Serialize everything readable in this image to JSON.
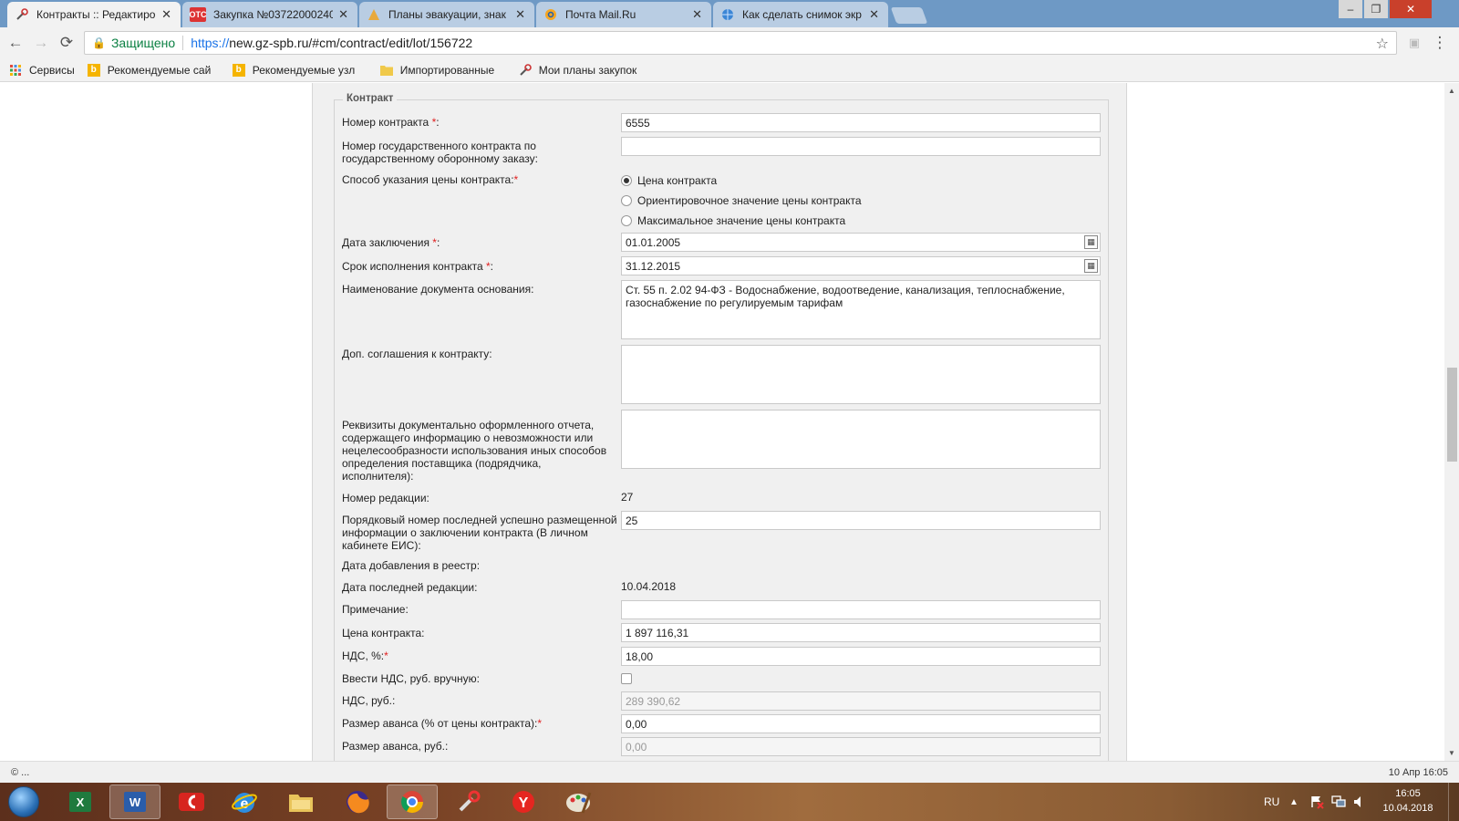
{
  "browser": {
    "tabs": [
      {
        "title": "Контракты :: Редактиров",
        "icon": "tools-icon",
        "active": true
      },
      {
        "title": "Закупка №03722000240",
        "icon": "otc-icon",
        "active": false
      },
      {
        "title": "Планы эвакуации, знак",
        "icon": "evac-icon",
        "active": false
      },
      {
        "title": "Почта Mail.Ru",
        "icon": "mail-icon",
        "active": false
      },
      {
        "title": "Как сделать снимок экр",
        "icon": "globe-icon",
        "active": false
      }
    ],
    "otc_badge": "OTC",
    "secure_label": "Защищено",
    "url_scheme": "https://",
    "url_host": "new.gz-spb.ru",
    "url_path": "/#cm/contract/edit/lot/156722",
    "bookmarks": [
      {
        "label": "Сервисы",
        "icon": "apps-icon"
      },
      {
        "label": "Рекомендуемые сай",
        "icon": "bing-icon"
      },
      {
        "label": "Рекомендуемые узл",
        "icon": "bing-icon"
      },
      {
        "label": "Импортированные",
        "icon": "folder-icon"
      },
      {
        "label": "Мои планы закупок",
        "icon": "tools-icon"
      }
    ]
  },
  "form": {
    "legend": "Контракт",
    "contract_number": {
      "label": "Номер контракта ",
      "value": "6555"
    },
    "gov_contract_number": {
      "label": "Номер государственного контракта по государственному оборонному заказу:",
      "value": ""
    },
    "price_method": {
      "label": "Способ указания цены контракта:",
      "options": [
        "Цена контракта",
        "Ориентировочное значение цены контракта",
        "Максимальное значение цены контракта"
      ],
      "selected": 0
    },
    "conclusion_date": {
      "label": "Дата заключения ",
      "value": "01.01.2005"
    },
    "execution_term": {
      "label": "Срок исполнения контракта ",
      "value": "31.12.2015"
    },
    "basis_document": {
      "label": "Наименование документа основания:",
      "value": "Ст. 55 п. 2.02 94-ФЗ - Водоснабжение, водоотведение, канализация, теплоснабжение, газоснабжение по регулируемым тарифам"
    },
    "supplementary": {
      "label": "Доп. соглашения к контракту:",
      "value": ""
    },
    "report_details": {
      "label": "Реквизиты документально оформленного отчета, содержащего информацию о невозможности или нецелесообразности использования иных способов определения поставщика (подрядчика, исполнителя):",
      "value": ""
    },
    "revision_number": {
      "label": "Номер редакции:",
      "value": "27"
    },
    "last_info_number": {
      "label": "Порядковый номер последней успешно размещенной информации о заключении контракта (В личном кабинете ЕИС):",
      "value": "25"
    },
    "registry_date": {
      "label": "Дата добавления в реестр:",
      "value": ""
    },
    "last_revision_date": {
      "label": "Дата последней редакции:",
      "value": "10.04.2018"
    },
    "note": {
      "label": "Примечание:",
      "value": ""
    },
    "contract_price": {
      "label": "Цена контракта:",
      "value": "1 897 116,31"
    },
    "vat_percent": {
      "label": "НДС, %:",
      "value": "18,00"
    },
    "vat_manual": {
      "label": "Ввести НДС, руб. вручную:",
      "checked": false
    },
    "vat_rub": {
      "label": "НДС, руб.:",
      "value": "289 390,62"
    },
    "advance_percent": {
      "label": "Размер аванса (% от цены контракта):",
      "value": "0,00"
    },
    "advance_rub": {
      "label": "Размер аванса, руб.:",
      "value": "0,00"
    },
    "required_mark": "*",
    "colon": ":"
  },
  "status": {
    "left": "© ...",
    "right": "10 Апр 16:05"
  },
  "taskbar": {
    "lang": "RU",
    "time": "16:05",
    "date": "10.04.2018"
  }
}
